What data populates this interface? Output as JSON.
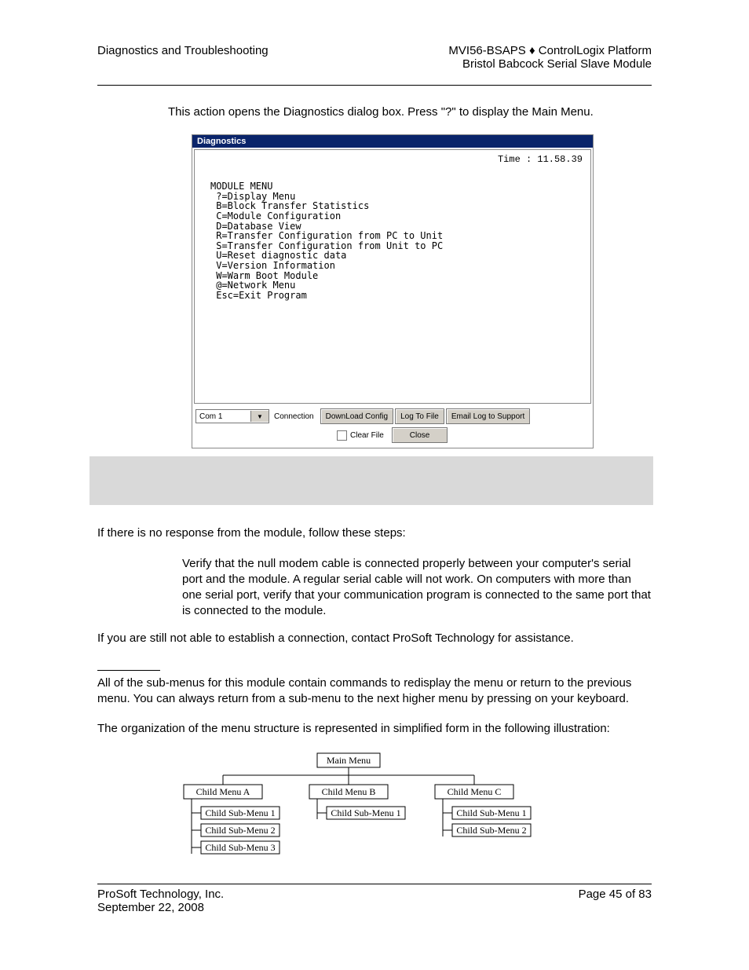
{
  "header": {
    "left": "Diagnostics and Troubleshooting",
    "right1": "MVI56-BSAPS ♦ ControlLogix Platform",
    "right2": "Bristol Babcock Serial Slave Module"
  },
  "para_intro": "This action opens the Diagnostics dialog box. Press \"?\" to display the Main Menu.",
  "dialog": {
    "title": "Diagnostics",
    "time": "Time : 11.58.39",
    "menu_text": "MODULE MENU\n ?=Display Menu\n B=Block Transfer Statistics\n C=Module Configuration\n D=Database View\n R=Transfer Configuration from PC to Unit\n S=Transfer Configuration from Unit to PC\n U=Reset diagnostic data\n V=Version Information\n W=Warm Boot Module\n @=Network Menu\n Esc=Exit Program",
    "combo_value": "Com 1",
    "connection_label": "Connection",
    "btn_download": "DownLoad Config",
    "btn_logfile": "Log To File",
    "btn_email": "Email Log to Support",
    "chk_clearfile": "Clear File",
    "btn_close": "Close"
  },
  "para_noresp": "If there is no response from the module, follow these steps:",
  "para_verify": "Verify that the null modem cable is connected properly between your computer's serial port and the module. A regular serial cable will not work. On computers with more than one serial port, verify that your communication program is connected to the same port that is connected to the module.",
  "para_assist": "If you are still not able to establish a connection, contact ProSoft Technology for assistance.",
  "para_submenus": "All of the sub-menus for this module contain commands to redisplay the menu or return to the previous menu. You can always return from a sub-menu to the next higher menu by pressing     on your keyboard.",
  "para_org": "The organization of the menu structure is represented in simplified form in the following illustration:",
  "diagram": {
    "main": "Main Menu",
    "a": "Child Menu A",
    "b": "Child Menu B",
    "c": "Child Menu C",
    "a1": "Child Sub-Menu 1",
    "a2": "Child Sub-Menu 2",
    "a3": "Child Sub-Menu 3",
    "b1": "Child Sub-Menu 1",
    "c1": "Child Sub-Menu 1",
    "c2": "Child Sub-Menu 2"
  },
  "footer": {
    "company": "ProSoft Technology, Inc.",
    "date": "September 22, 2008",
    "page": "Page 45 of 83"
  }
}
